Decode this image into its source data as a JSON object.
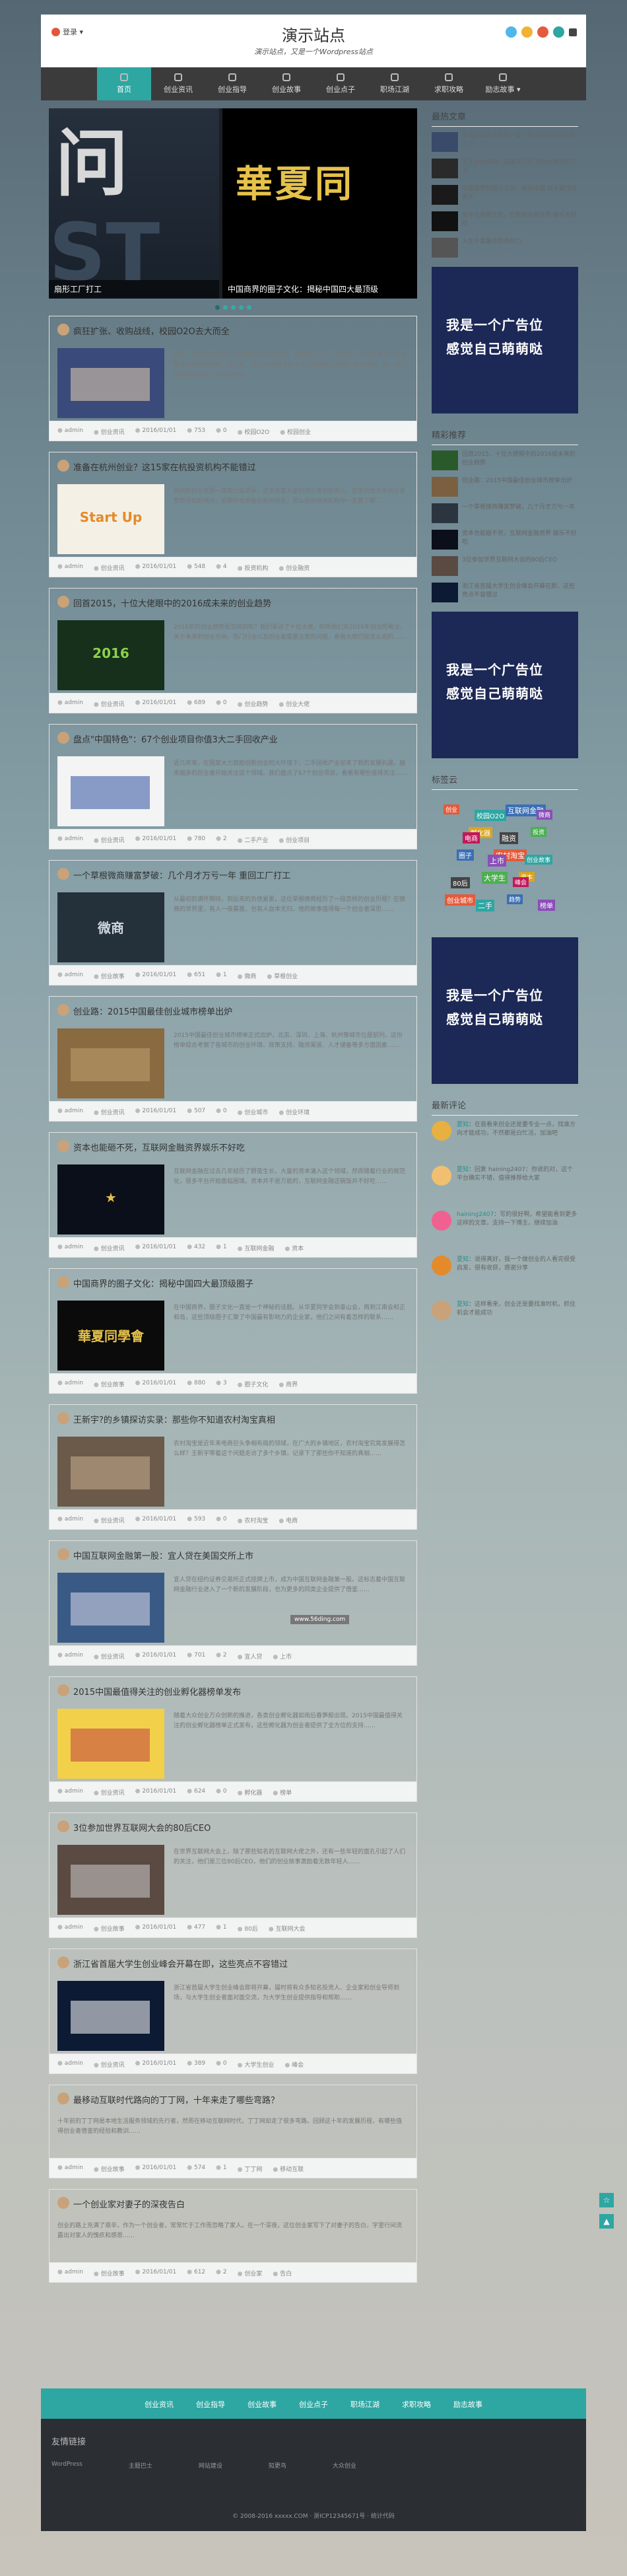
{
  "header": {
    "login_label": "登录 ▾",
    "site_title": "演示站点",
    "slogan": "演示站点，又是一个Wordpress站点"
  },
  "nav": {
    "items": [
      "首页",
      "创业资讯",
      "创业指导",
      "创业故事",
      "创业点子",
      "职场江湖",
      "求职攻略",
      "励志故事 ▾"
    ]
  },
  "slider": {
    "left_caption": "扇形工厂打工",
    "right_caption": "中国商界的圈子文化：揭秘中国四大最顶级"
  },
  "posts": [
    {
      "title": "疯狂扩张、收购战线，校园O2O去大而全",
      "excerpt": "导读：校园O2O在经历过前期的不停扩张后，纷纷进入了一个洗牌期，业内普遍认为行业整合是必然的趋势。近几年，在O2O领域中有不少公司采取了持续扩张的战略，但一些公司也因此付出了沉重的代价……",
      "meta": [
        "admin",
        "创业资讯",
        "2016/01/01",
        "753",
        "0",
        "校园O2O",
        "校园创业"
      ]
    },
    {
      "title": "准备在杭州创业？这15家在杭投资机构不能错过",
      "excerpt": "杭州的创业氛围一直都比较浓厚，这里有着大量的创业者和投资人，这里也是许多创业者梦想开始的地方。如果你也准备在杭州创业，那么这些投资机构你一定要了解……",
      "meta": [
        "admin",
        "创业资讯",
        "2016/01/01",
        "548",
        "4",
        "投资机构",
        "创业融资"
      ]
    },
    {
      "title": "回首2015，十位大佬眼中的2016成未来的创业趋势",
      "excerpt": "2016年的创业趋势是怎样的呢？我们采访了十位大佬，听听他们对2016年创业的看法，关于未来的创业方向、热门行业以及创业者需要注意的问题，看看大佬们是怎么说的……",
      "meta": [
        "admin",
        "创业资讯",
        "2016/01/01",
        "689",
        "0",
        "创业趋势",
        "创业大佬"
      ]
    },
    {
      "title": "盘点\"中国特色\"：67个创业项目你值3大二手回收产业",
      "excerpt": "近几年来，在国家大力鼓励创新创业的大环境下，二手回收产业迎来了新的发展机遇，越来越多的创业者开始关注这个领域。我们盘点了67个创业项目，看看有哪些值得关注……",
      "meta": [
        "admin",
        "创业资讯",
        "2016/01/01",
        "780",
        "2",
        "二手产业",
        "创业项目"
      ]
    },
    {
      "title": "一个草根微商赚富梦破：几个月才万亏一年 重回工厂打工",
      "excerpt": "从最初的满怀期待，到后来的负债累累，这位草根微商经历了一段怎样的创业历程？在微商的世界里，有人一夜暴富，也有人血本无归，他的故事值得每一个创业者深思……",
      "meta": [
        "admin",
        "创业故事",
        "2016/01/01",
        "651",
        "1",
        "微商",
        "草根创业"
      ]
    },
    {
      "title": "创业路：2015中国最佳创业城市榜单出炉",
      "excerpt": "2015中国最佳创业城市榜单正式出炉，北京、深圳、上海、杭州等城市位居前列。这份榜单综合考察了各城市的创业环境、政策支持、融资渠道、人才储备等多方面因素……",
      "meta": [
        "admin",
        "创业资讯",
        "2016/01/01",
        "507",
        "0",
        "创业城市",
        "创业环境"
      ]
    },
    {
      "title": "资本也能砸不死，互联网金融资界娱乐不好吃",
      "excerpt": "互联网金融在过去几年经历了野蛮生长，大量的资本涌入这个领域，然而随着行业的规范化，很多平台开始面临困境。资本并不是万能的，互联网金融这碗饭并不好吃……",
      "meta": [
        "admin",
        "创业资讯",
        "2016/01/01",
        "432",
        "1",
        "互联网金融",
        "资本"
      ]
    },
    {
      "title": "中国商界的圈子文化：揭秘中国四大最顶级圈子",
      "excerpt": "在中国商界，圈子文化一直是一个神秘的话题。从华夏同学会到泰山会，再到江南会和正和岛，这些顶级圈子汇聚了中国最有影响力的企业家，他们之间有着怎样的联系……",
      "meta": [
        "admin",
        "创业故事",
        "2016/01/01",
        "880",
        "3",
        "圈子文化",
        "商界"
      ]
    },
    {
      "title": "王新宇?的乡镇探访实录：那些你不知道农村淘宝真相",
      "excerpt": "农村淘宝是近年来电商巨头争相布局的领域，在广大的乡镇地区，农村淘宝究竟发展得怎么样？王新宇带着这个问题走访了多个乡镇，记录下了那些你不知道的真相……",
      "meta": [
        "admin",
        "创业资讯",
        "2016/01/01",
        "593",
        "0",
        "农村淘宝",
        "电商"
      ]
    },
    {
      "title": "中国互联网金融第一股：宜人贷在美国交所上市",
      "excerpt": "宜人贷在纽约证券交易所正式挂牌上市，成为中国互联网金融第一股。这标志着中国互联网金融行业进入了一个新的发展阶段，也为更多的同类企业提供了借鉴……",
      "meta": [
        "admin",
        "创业资讯",
        "2016/01/01",
        "701",
        "2",
        "宜人贷",
        "上市"
      ]
    },
    {
      "title": "2015中国最值得关注的创业孵化器榜单发布",
      "excerpt": "随着大众创业万众创新的推进，各类创业孵化器如雨后春笋般出现。2015中国最值得关注的创业孵化器榜单正式发布，这些孵化器为创业者提供了全方位的支持……",
      "meta": [
        "admin",
        "创业资讯",
        "2016/01/01",
        "624",
        "0",
        "孵化器",
        "榜单"
      ]
    },
    {
      "title": "3位参加世界互联网大会的80后CEO",
      "excerpt": "在世界互联网大会上，除了那些知名的互联网大佬之外，还有一些年轻的面孔引起了人们的关注，他们是三位80后CEO，他们的创业故事激励着无数年轻人……",
      "meta": [
        "admin",
        "创业故事",
        "2016/01/01",
        "477",
        "1",
        "80后",
        "互联网大会"
      ]
    },
    {
      "title": "浙江省首届大学生创业峰会开幕在即，这些亮点不容错过",
      "excerpt": "浙江省首届大学生创业峰会即将开幕，届时将有众多知名投资人、企业家和创业导师到场，与大学生创业者面对面交流，为大学生创业提供指导和帮助……",
      "meta": [
        "admin",
        "创业资讯",
        "2016/01/01",
        "389",
        "0",
        "大学生创业",
        "峰会"
      ]
    },
    {
      "title": "最移动互联时代路向的丁丁网，十年来走了哪些弯路？",
      "excerpt": "十年前的丁丁网是本地生活服务领域的先行者，然而在移动互联网时代，丁丁网却走了很多弯路。回顾这十年的发展历程，有哪些值得创业者借鉴的经验和教训……",
      "meta": [
        "admin",
        "创业故事",
        "2016/01/01",
        "574",
        "1",
        "丁丁网",
        "移动互联"
      ]
    },
    {
      "title": "一个创业家对妻子的深夜告白",
      "excerpt": "创业的路上充满了艰辛，作为一个创业者，常常忙于工作而忽略了家人。在一个深夜，这位创业家写下了对妻子的告白，字里行间流露出对家人的愧疚和感恩……",
      "meta": [
        "admin",
        "创业故事",
        "2016/01/01",
        "612",
        "2",
        "创业家",
        "告白"
      ]
    }
  ],
  "sidebar": {
    "hot_title": "最热文章",
    "hot": [
      "中国互联网金融第一股：宜人贷在美国交所上市",
      "华人创业指南：骗遍天下的 找创业项目的方法",
      "中国商界的圈子文化：揭秘中国 四大最顶级圈子",
      "资本也能砸不死，互联网金融资界 娱乐不好吃",
      "人生不需要怨怨再努力"
    ],
    "ad_line1": "我是一个广告位",
    "ad_line2": "感觉自己萌萌哒",
    "rec_title": "精彩推荐",
    "rec": [
      "回首2015，十位大佬眼中的2016成未来的创业趋势",
      "创业路：2015中国最佳创业城市榜单出炉",
      "一个草根微商赚富梦破，几个月才万亏一年",
      "资本也能砸不死，互联网金融资界 娱乐不好吃",
      "3位参加世界互联网大会的80后CEO",
      "浙江省首届大学生创业峰会开幕在即，这些亮点不容错过"
    ],
    "tags_title": "标签云",
    "tags": [
      "创业",
      "校园O2O",
      "互联网金融",
      "微商",
      "孵化器",
      "融资",
      "投资",
      "电商",
      "农村淘宝",
      "创业故事",
      "圈子",
      "上市",
      "资本",
      "80后",
      "大学生",
      "峰会",
      "创业城市",
      "二手",
      "趋势",
      "榜单"
    ],
    "comments_title": "最新评论",
    "comments": [
      {
        "name": "夏知",
        "text": "：在我看来创业还是要专业一点，找准方向才能成功，不然都是白忙活，加油吧"
      },
      {
        "name": "夏知",
        "text": "：回复 haining2407：你说的对，这个平台确实不错，值得推荐给大家"
      },
      {
        "name": "haining2407",
        "text": "：写的很好啊，希望能看到更多这样的文章，支持一下博主，继续加油"
      },
      {
        "name": "夏知",
        "text": "：说得真好，我一个做创业的人看完很受启发，很有收获，感谢分享"
      },
      {
        "name": "夏知",
        "text": "：这样看来，创业还是要找准时机，抓住机会才能成功"
      }
    ]
  },
  "bottom_nav": [
    "创业资讯",
    "创业指导",
    "创业故事",
    "创业点子",
    "职场江湖",
    "求职攻略",
    "励志故事"
  ],
  "footer": {
    "links_title": "友情链接",
    "links": [
      "WordPress",
      "主题巴士",
      "网站建设",
      "知更鸟",
      "大众创业"
    ],
    "copyright": "© 2008-2016 xxxxx.COM · 浙ICP12345671号 · 统计代码"
  },
  "watermark": "www.56ding.com",
  "colors": {
    "accent": "#2ea6a2",
    "nav_bg": "#3b3b3b",
    "ad_bg": "#1c2856",
    "footer_bg": "#2b2f33"
  }
}
